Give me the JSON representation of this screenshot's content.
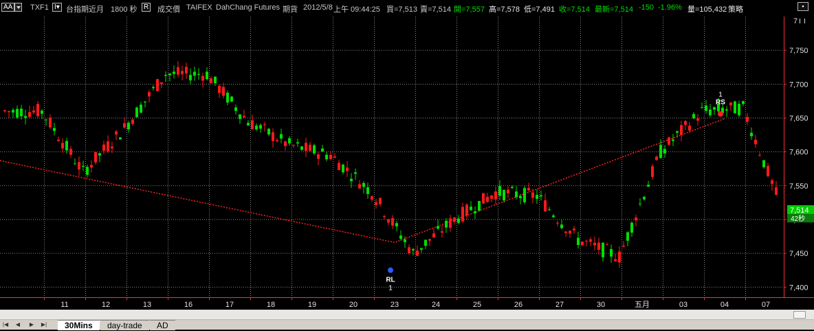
{
  "header": {
    "size_box": "AA",
    "symbol": "TXF1",
    "instrument_label": "台指期近月",
    "interval": "1800 秒",
    "price_type_box": "R",
    "price_type": "成交價",
    "exchange": "TAIFEX",
    "broker": "DahChang Futures",
    "category": "期貨",
    "date": "2012/5/8",
    "time": "上午 09:44:25",
    "bid": "買=7,513",
    "ask": "賣=7,514",
    "open": "開=7,557",
    "high": "高=7,578",
    "low": "低=7,491",
    "close": "收=7,514",
    "last": "最新=7,514",
    "change": "-150",
    "change_pct": "-1.96%",
    "volume": "量=105,432",
    "strategy": "策略"
  },
  "right_panel": {
    "top_label": "7",
    "current_price": "7,514",
    "countdown": "42秒"
  },
  "markers": {
    "rl_label": "RL",
    "rl_count": "1",
    "rs_label": "RS",
    "rs_count": "1"
  },
  "tabs": [
    "30Mins",
    "day-trade",
    "AD"
  ],
  "colors": {
    "up": "#ff1a1a",
    "down": "#00e000",
    "background": "#000000",
    "grid": "#8a8a8a",
    "trendline": "#ff2020",
    "axis": "#ff3030",
    "price_badge": "#00cc00"
  },
  "chart_data": {
    "type": "candlestick",
    "symbol": "TXF1",
    "interval_seconds": 1800,
    "ylim": [
      7385,
      7800
    ],
    "y_ticks": [
      7400,
      7450,
      7500,
      7550,
      7600,
      7650,
      7700,
      7750
    ],
    "y_tick_labels": [
      "7,400",
      "7,450",
      "7,500",
      "7,550",
      "7,600",
      "7,650",
      "7,700",
      "7,750"
    ],
    "x_tick_labels": [
      "11",
      "12",
      "13",
      "16",
      "17",
      "18",
      "19",
      "20",
      "23",
      "24",
      "25",
      "26",
      "27",
      "30",
      "五月",
      "03",
      "04",
      "07"
    ],
    "trading_days": [
      {
        "label": "",
        "close": 7660
      },
      {
        "label": "11",
        "close": 7570
      },
      {
        "label": "12",
        "close": 7635
      },
      {
        "label": "13",
        "close": 7715
      },
      {
        "label": "16",
        "close": 7715
      },
      {
        "label": "17",
        "close": 7645
      },
      {
        "label": "18",
        "close": 7610
      },
      {
        "label": "19",
        "close": 7595
      },
      {
        "label": "20",
        "close": 7540
      },
      {
        "label": "23",
        "close": 7450
      },
      {
        "label": "24",
        "close": 7500
      },
      {
        "label": "25",
        "close": 7540
      },
      {
        "label": "26",
        "close": 7535
      },
      {
        "label": "27",
        "close": 7470
      },
      {
        "label": "30",
        "close": 7445
      },
      {
        "label": "五月",
        "close": 7600
      },
      {
        "label": "03",
        "close": 7660
      },
      {
        "label": "04",
        "close": 7665
      },
      {
        "label": "07",
        "close": 7505
      }
    ],
    "current_price": 7514,
    "trendline": [
      {
        "day": "",
        "value": 7587
      },
      {
        "day": "23",
        "value": 7466
      },
      {
        "day": "04",
        "value": 7649
      }
    ],
    "signals": [
      {
        "label": "RL",
        "count": "1",
        "day": "23",
        "price": 7425
      },
      {
        "label": "RS",
        "count": "1",
        "day": "04",
        "price": 7662
      }
    ],
    "grid": true
  }
}
